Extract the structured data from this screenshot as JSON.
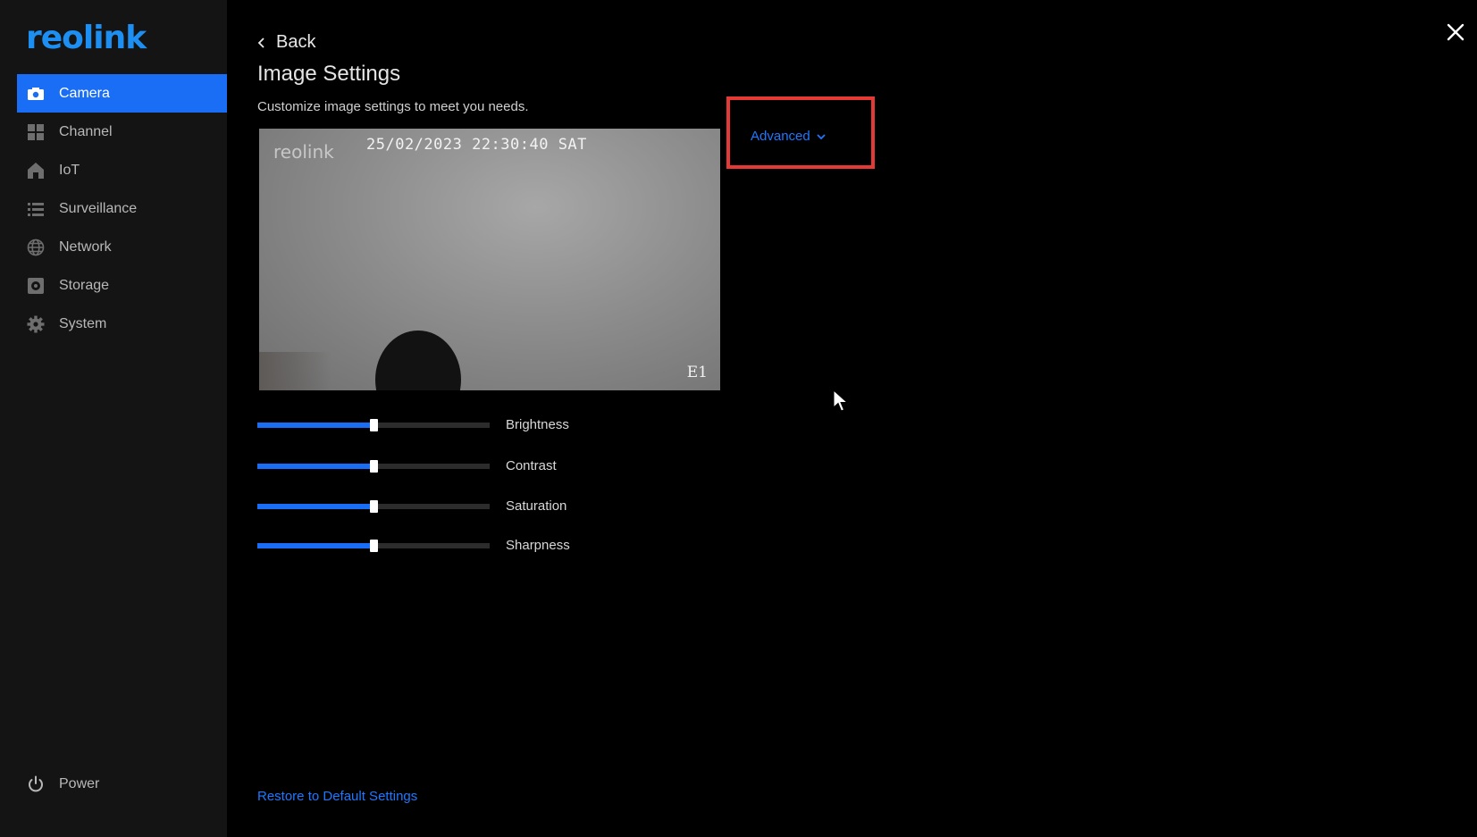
{
  "logo": "reolink",
  "sidebar": {
    "items": [
      {
        "label": "Camera",
        "icon": "camera-icon",
        "active": true
      },
      {
        "label": "Channel",
        "icon": "grid-icon",
        "active": false
      },
      {
        "label": "IoT",
        "icon": "home-icon",
        "active": false
      },
      {
        "label": "Surveillance",
        "icon": "list-icon",
        "active": false
      },
      {
        "label": "Network",
        "icon": "globe-icon",
        "active": false
      },
      {
        "label": "Storage",
        "icon": "storage-icon",
        "active": false
      },
      {
        "label": "System",
        "icon": "gear-icon",
        "active": false
      }
    ],
    "power_label": "Power"
  },
  "header": {
    "back_label": "Back",
    "title": "Image Settings",
    "subtitle": "Customize image settings to meet you needs."
  },
  "preview": {
    "watermark": "reolink",
    "timestamp": "25/02/2023 22:30:40 SAT",
    "channel": "E1"
  },
  "advanced_label": "Advanced",
  "sliders": [
    {
      "label": "Brightness",
      "value": 0.5
    },
    {
      "label": "Contrast",
      "value": 0.5
    },
    {
      "label": "Saturation",
      "value": 0.5
    },
    {
      "label": "Sharpness",
      "value": 0.5
    }
  ],
  "restore_label": "Restore to Default Settings",
  "colors": {
    "accent": "#1a6ef5",
    "link": "#1e78ff",
    "highlight": "#e53935",
    "sidebar_bg": "#141414"
  }
}
